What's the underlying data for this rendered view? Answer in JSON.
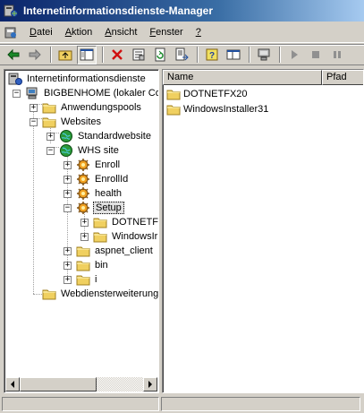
{
  "window": {
    "title": "Internetinformationsdienste-Manager"
  },
  "menu": [
    {
      "label": "Datei",
      "accel": "D",
      "rest": "atei"
    },
    {
      "label": "Aktion",
      "accel": "A",
      "rest": "ktion"
    },
    {
      "label": "Ansicht",
      "accel": "A",
      "rest": "nsicht"
    },
    {
      "label": "Fenster",
      "accel": "F",
      "rest": "enster"
    },
    {
      "label": "?",
      "accel": "?",
      "rest": ""
    }
  ],
  "tree": {
    "root": "Internetinformationsdienste",
    "server": "BIGBENHOME (lokaler Com",
    "app_pools": "Anwendungspools",
    "websites": "Websites",
    "default_site": "Standardwebsite",
    "whs_site": "WHS site",
    "enroll": "Enroll",
    "enroll_id": "EnrollId",
    "health": "health",
    "setup": "Setup",
    "dotnetfx": "DOTNETFX",
    "windowsinstaller": "WindowsIr",
    "aspnet_client": "aspnet_client",
    "bin": "bin",
    "i": "i",
    "web_ext": "Webdiensterweiterung"
  },
  "list": {
    "columns": [
      "Name",
      "Pfad"
    ],
    "items": [
      "DOTNETFX20",
      "WindowsInstaller31"
    ]
  },
  "colors": {
    "titlebar_start": "#0a246a",
    "titlebar_end": "#a6caf0",
    "chrome": "#d4d0c8",
    "folder": "#f0d060"
  }
}
